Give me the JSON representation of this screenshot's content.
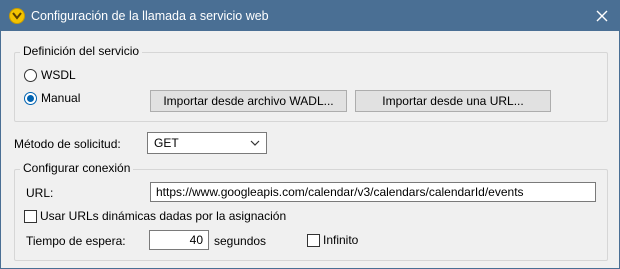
{
  "window": {
    "title": "Configuración de la llamada a servicio web",
    "colors": {
      "titlebar": "#4a6f94",
      "accent": "#0063b1",
      "app_icon": "#f3c300"
    }
  },
  "service_definition": {
    "legend": "Definición del servicio",
    "options": [
      {
        "label": "WSDL",
        "checked": false
      },
      {
        "label": "Manual",
        "checked": true
      }
    ],
    "import_wadl_label": "Importar desde archivo WADL...",
    "import_url_label": "Importar desde una URL..."
  },
  "request_method": {
    "label": "Método de solicitud:",
    "value": "GET"
  },
  "connection": {
    "legend": "Configurar conexión",
    "url_label": "URL:",
    "url_value": "https://www.googleapis.com/calendar/v3/calendars/calendarId/events",
    "dynamic_urls_label": "Usar URLs dinámicas dadas por la asignación",
    "timeout_label": "Tiempo de espera:",
    "timeout_value": "40",
    "timeout_unit": "segundos",
    "infinite_label": "Infinito"
  },
  "icons": {
    "app": "altova-app-icon",
    "close": "close-icon",
    "dropdown": "chevron-down-icon"
  }
}
